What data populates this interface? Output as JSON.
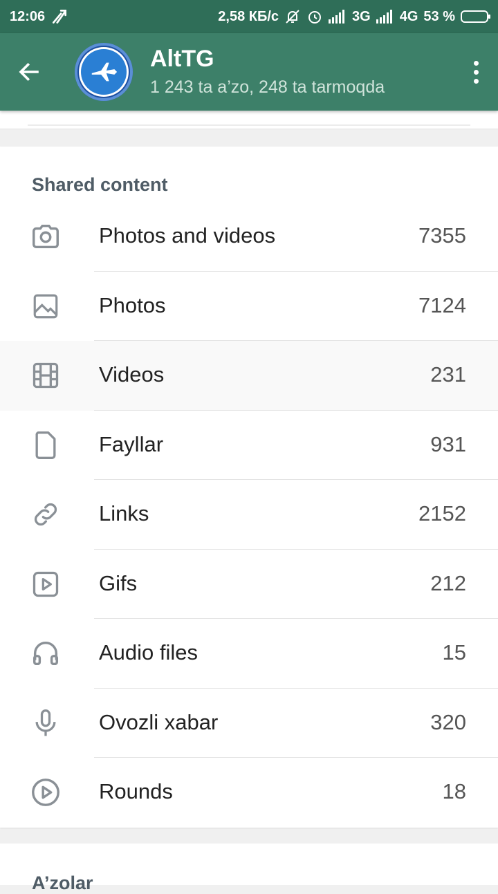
{
  "status_bar": {
    "time": "12:06",
    "speed": "2,58 КБ/с",
    "net1": "3G",
    "net2": "4G",
    "battery": "53 %",
    "battery_level": 0.53
  },
  "header": {
    "title": "AltTG",
    "subtitle": "1 243 ta a’zo, 248 ta tarmoqda"
  },
  "shared": {
    "title": "Shared content",
    "items": [
      {
        "label": "Photos and videos",
        "count": "7355",
        "icon": "camera-icon"
      },
      {
        "label": "Photos",
        "count": "7124",
        "icon": "image-icon"
      },
      {
        "label": "Videos",
        "count": "231",
        "icon": "film-icon"
      },
      {
        "label": "Fayllar",
        "count": "931",
        "icon": "file-icon"
      },
      {
        "label": "Links",
        "count": "2152",
        "icon": "link-icon"
      },
      {
        "label": "Gifs",
        "count": "212",
        "icon": "gif-play-icon"
      },
      {
        "label": "Audio files",
        "count": "15",
        "icon": "headphones-icon"
      },
      {
        "label": "Ovozli xabar",
        "count": "320",
        "icon": "microphone-icon"
      },
      {
        "label": "Rounds",
        "count": "18",
        "icon": "round-video-icon"
      }
    ]
  },
  "members": {
    "title": "A’zolar"
  },
  "colors": {
    "status_bar": "#2f6e58",
    "action_bar": "#3d8069",
    "icon_gray": "#8a9096"
  }
}
